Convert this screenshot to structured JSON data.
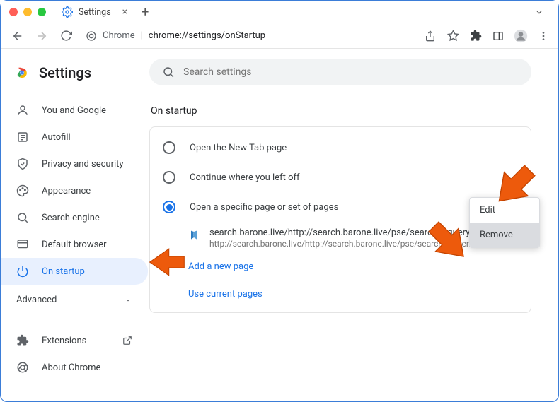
{
  "window": {
    "tab_title": "Settings",
    "address_app_label": "Chrome",
    "address_url": "chrome://settings/onStartup"
  },
  "search": {
    "placeholder": "Search settings"
  },
  "brand": {
    "title": "Settings"
  },
  "sidebar": {
    "items": [
      {
        "label": "You and Google",
        "icon": "person"
      },
      {
        "label": "Autofill",
        "icon": "autofill"
      },
      {
        "label": "Privacy and security",
        "icon": "shield"
      },
      {
        "label": "Appearance",
        "icon": "palette"
      },
      {
        "label": "Search engine",
        "icon": "search"
      },
      {
        "label": "Default browser",
        "icon": "browser"
      },
      {
        "label": "On startup",
        "icon": "power"
      }
    ],
    "advanced_label": "Advanced",
    "extensions_label": "Extensions",
    "about_label": "About Chrome"
  },
  "startup": {
    "section_title": "On startup",
    "options": [
      {
        "label": "Open the New Tab page"
      },
      {
        "label": "Continue where you left off"
      },
      {
        "label": "Open a specific page or set of pages"
      }
    ],
    "pages": [
      {
        "title": "search.barone.live/http://search.barone.live/pse/search?&query=%s&",
        "url": "http://search.barone.live/http://search.barone.live/pse/search?&quer…"
      }
    ],
    "add_page_label": "Add a new page",
    "use_current_label": "Use current pages"
  },
  "context_menu": {
    "edit_label": "Edit",
    "remove_label": "Remove"
  },
  "colors": {
    "accent": "#1a73e8",
    "arrow": "#ed5a0c"
  }
}
